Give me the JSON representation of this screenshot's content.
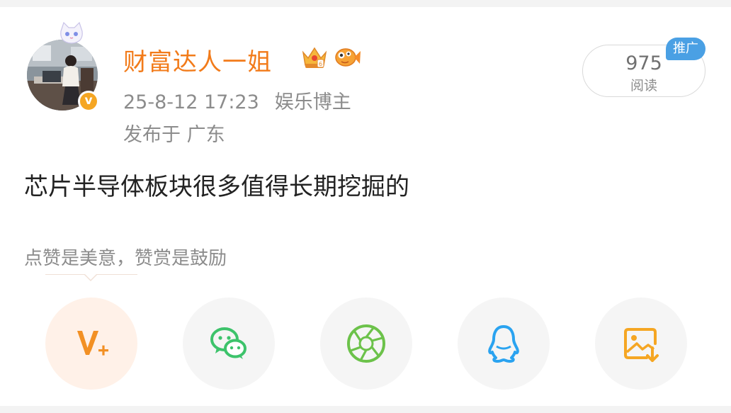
{
  "post": {
    "author": {
      "name": "财富达人一姐",
      "verified_symbol": "v",
      "badges": [
        "crown-badge-icon",
        "goldfish-badge-icon"
      ]
    },
    "timestamp": "25-8-12 17:23",
    "category": "娱乐博主",
    "location": "发布于 广东",
    "content": "芯片半导体板块很多值得长期挖掘的",
    "read_count": "975",
    "read_label": "阅读",
    "promo_label": "推广",
    "reward_tip": "点赞是美意，赞赏是鼓励"
  },
  "share_actions": [
    {
      "icon": "reward-v-plus-icon",
      "active": true
    },
    {
      "icon": "wechat-icon"
    },
    {
      "icon": "moments-icon"
    },
    {
      "icon": "qq-icon"
    },
    {
      "icon": "save-image-icon"
    }
  ],
  "colors": {
    "author_name": "#f27b1a",
    "verified": "#f5a623",
    "promo": "#4aa0e4",
    "wechat": "#3dc36b",
    "moments": "#6cc24a",
    "qq": "#2aa3f0",
    "reward": "#f29024",
    "save": "#f5a623",
    "secondary_text": "#8c8c8c"
  }
}
